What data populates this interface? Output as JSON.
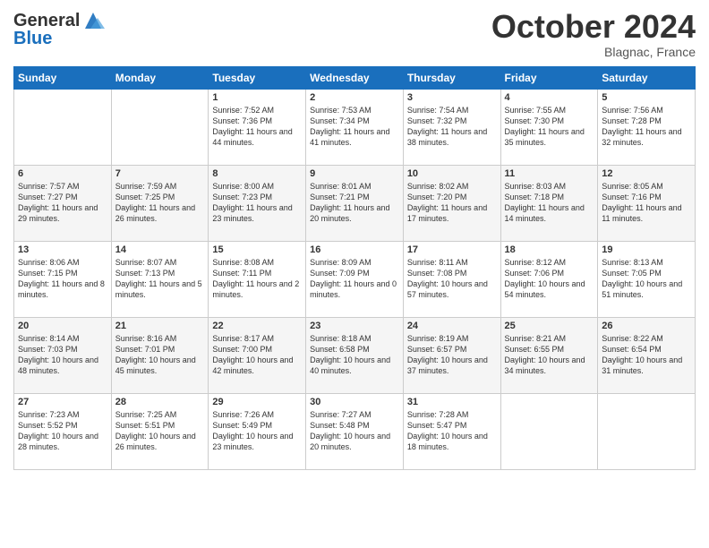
{
  "header": {
    "logo_general": "General",
    "logo_blue": "Blue",
    "month": "October 2024",
    "location": "Blagnac, France"
  },
  "weekdays": [
    "Sunday",
    "Monday",
    "Tuesday",
    "Wednesday",
    "Thursday",
    "Friday",
    "Saturday"
  ],
  "weeks": [
    [
      {
        "day": "",
        "sunrise": "",
        "sunset": "",
        "daylight": ""
      },
      {
        "day": "",
        "sunrise": "",
        "sunset": "",
        "daylight": ""
      },
      {
        "day": "1",
        "sunrise": "Sunrise: 7:52 AM",
        "sunset": "Sunset: 7:36 PM",
        "daylight": "Daylight: 11 hours and 44 minutes."
      },
      {
        "day": "2",
        "sunrise": "Sunrise: 7:53 AM",
        "sunset": "Sunset: 7:34 PM",
        "daylight": "Daylight: 11 hours and 41 minutes."
      },
      {
        "day": "3",
        "sunrise": "Sunrise: 7:54 AM",
        "sunset": "Sunset: 7:32 PM",
        "daylight": "Daylight: 11 hours and 38 minutes."
      },
      {
        "day": "4",
        "sunrise": "Sunrise: 7:55 AM",
        "sunset": "Sunset: 7:30 PM",
        "daylight": "Daylight: 11 hours and 35 minutes."
      },
      {
        "day": "5",
        "sunrise": "Sunrise: 7:56 AM",
        "sunset": "Sunset: 7:28 PM",
        "daylight": "Daylight: 11 hours and 32 minutes."
      }
    ],
    [
      {
        "day": "6",
        "sunrise": "Sunrise: 7:57 AM",
        "sunset": "Sunset: 7:27 PM",
        "daylight": "Daylight: 11 hours and 29 minutes."
      },
      {
        "day": "7",
        "sunrise": "Sunrise: 7:59 AM",
        "sunset": "Sunset: 7:25 PM",
        "daylight": "Daylight: 11 hours and 26 minutes."
      },
      {
        "day": "8",
        "sunrise": "Sunrise: 8:00 AM",
        "sunset": "Sunset: 7:23 PM",
        "daylight": "Daylight: 11 hours and 23 minutes."
      },
      {
        "day": "9",
        "sunrise": "Sunrise: 8:01 AM",
        "sunset": "Sunset: 7:21 PM",
        "daylight": "Daylight: 11 hours and 20 minutes."
      },
      {
        "day": "10",
        "sunrise": "Sunrise: 8:02 AM",
        "sunset": "Sunset: 7:20 PM",
        "daylight": "Daylight: 11 hours and 17 minutes."
      },
      {
        "day": "11",
        "sunrise": "Sunrise: 8:03 AM",
        "sunset": "Sunset: 7:18 PM",
        "daylight": "Daylight: 11 hours and 14 minutes."
      },
      {
        "day": "12",
        "sunrise": "Sunrise: 8:05 AM",
        "sunset": "Sunset: 7:16 PM",
        "daylight": "Daylight: 11 hours and 11 minutes."
      }
    ],
    [
      {
        "day": "13",
        "sunrise": "Sunrise: 8:06 AM",
        "sunset": "Sunset: 7:15 PM",
        "daylight": "Daylight: 11 hours and 8 minutes."
      },
      {
        "day": "14",
        "sunrise": "Sunrise: 8:07 AM",
        "sunset": "Sunset: 7:13 PM",
        "daylight": "Daylight: 11 hours and 5 minutes."
      },
      {
        "day": "15",
        "sunrise": "Sunrise: 8:08 AM",
        "sunset": "Sunset: 7:11 PM",
        "daylight": "Daylight: 11 hours and 2 minutes."
      },
      {
        "day": "16",
        "sunrise": "Sunrise: 8:09 AM",
        "sunset": "Sunset: 7:09 PM",
        "daylight": "Daylight: 11 hours and 0 minutes."
      },
      {
        "day": "17",
        "sunrise": "Sunrise: 8:11 AM",
        "sunset": "Sunset: 7:08 PM",
        "daylight": "Daylight: 10 hours and 57 minutes."
      },
      {
        "day": "18",
        "sunrise": "Sunrise: 8:12 AM",
        "sunset": "Sunset: 7:06 PM",
        "daylight": "Daylight: 10 hours and 54 minutes."
      },
      {
        "day": "19",
        "sunrise": "Sunrise: 8:13 AM",
        "sunset": "Sunset: 7:05 PM",
        "daylight": "Daylight: 10 hours and 51 minutes."
      }
    ],
    [
      {
        "day": "20",
        "sunrise": "Sunrise: 8:14 AM",
        "sunset": "Sunset: 7:03 PM",
        "daylight": "Daylight: 10 hours and 48 minutes."
      },
      {
        "day": "21",
        "sunrise": "Sunrise: 8:16 AM",
        "sunset": "Sunset: 7:01 PM",
        "daylight": "Daylight: 10 hours and 45 minutes."
      },
      {
        "day": "22",
        "sunrise": "Sunrise: 8:17 AM",
        "sunset": "Sunset: 7:00 PM",
        "daylight": "Daylight: 10 hours and 42 minutes."
      },
      {
        "day": "23",
        "sunrise": "Sunrise: 8:18 AM",
        "sunset": "Sunset: 6:58 PM",
        "daylight": "Daylight: 10 hours and 40 minutes."
      },
      {
        "day": "24",
        "sunrise": "Sunrise: 8:19 AM",
        "sunset": "Sunset: 6:57 PM",
        "daylight": "Daylight: 10 hours and 37 minutes."
      },
      {
        "day": "25",
        "sunrise": "Sunrise: 8:21 AM",
        "sunset": "Sunset: 6:55 PM",
        "daylight": "Daylight: 10 hours and 34 minutes."
      },
      {
        "day": "26",
        "sunrise": "Sunrise: 8:22 AM",
        "sunset": "Sunset: 6:54 PM",
        "daylight": "Daylight: 10 hours and 31 minutes."
      }
    ],
    [
      {
        "day": "27",
        "sunrise": "Sunrise: 7:23 AM",
        "sunset": "Sunset: 5:52 PM",
        "daylight": "Daylight: 10 hours and 28 minutes."
      },
      {
        "day": "28",
        "sunrise": "Sunrise: 7:25 AM",
        "sunset": "Sunset: 5:51 PM",
        "daylight": "Daylight: 10 hours and 26 minutes."
      },
      {
        "day": "29",
        "sunrise": "Sunrise: 7:26 AM",
        "sunset": "Sunset: 5:49 PM",
        "daylight": "Daylight: 10 hours and 23 minutes."
      },
      {
        "day": "30",
        "sunrise": "Sunrise: 7:27 AM",
        "sunset": "Sunset: 5:48 PM",
        "daylight": "Daylight: 10 hours and 20 minutes."
      },
      {
        "day": "31",
        "sunrise": "Sunrise: 7:28 AM",
        "sunset": "Sunset: 5:47 PM",
        "daylight": "Daylight: 10 hours and 18 minutes."
      },
      {
        "day": "",
        "sunrise": "",
        "sunset": "",
        "daylight": ""
      },
      {
        "day": "",
        "sunrise": "",
        "sunset": "",
        "daylight": ""
      }
    ]
  ]
}
